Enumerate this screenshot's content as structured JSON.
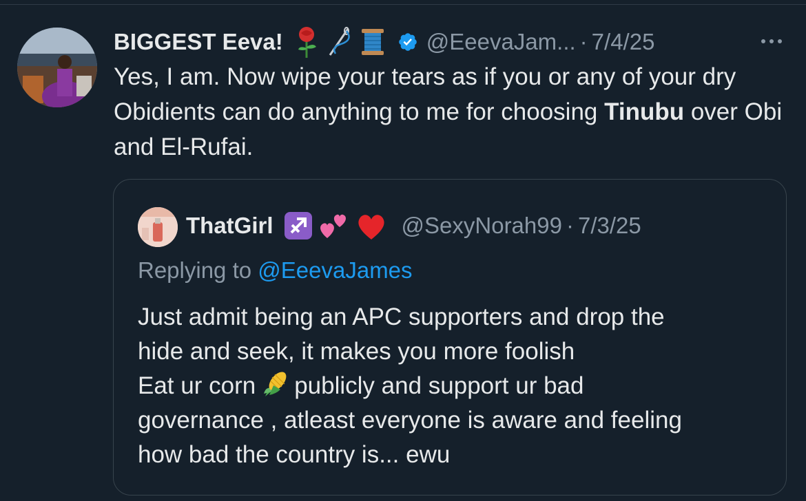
{
  "tweet": {
    "author_name": "BIGGEST Eeva!",
    "author_emojis": [
      "rose-icon",
      "needle-thread-icon",
      "spool-icon"
    ],
    "verified": true,
    "handle": "@EeevaJam...",
    "separator": "·",
    "date": "7/4/25",
    "text_part1": "Yes, I am. Now wipe your tears as if you or any of your dry Obidients can do anything to me for choosing ",
    "text_bold": "Tinubu",
    "text_part2": " over Obi and El-Rufai."
  },
  "quoted_tweet": {
    "author_name": "ThatGirl",
    "author_emojis": [
      "sagittarius-icon",
      "two-hearts-icon",
      "red-heart-icon"
    ],
    "handle": "@SexyNorah99",
    "separator": "·",
    "date": "7/3/25",
    "replying_prefix": "Replying to ",
    "replying_mention": "@EeevaJames",
    "line1": "Just admit being an APC supporters and drop the",
    "line2": "hide and seek, it makes you more foolish",
    "line3a": "Eat ur corn",
    "line3b": "publicly and support ur bad",
    "line4": "governance , atleast everyone is aware and feeling",
    "line5": "how bad the country is... ewu"
  },
  "colors": {
    "background": "#15202b",
    "primary_text": "#e7e9ea",
    "secondary_text": "#8b98a5",
    "link": "#1d9bf0",
    "border": "#38444d"
  }
}
